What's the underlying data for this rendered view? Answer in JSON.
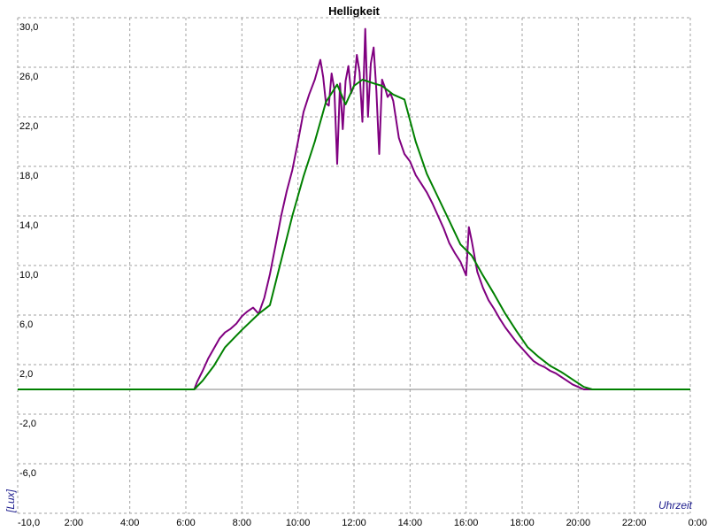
{
  "chart_data": {
    "type": "line",
    "title": "Helligkeit",
    "ylabel": "[Lux]",
    "xlabel": "Uhrzeit",
    "ylim": [
      -10,
      30
    ],
    "xlim": [
      0,
      24
    ],
    "y_ticks": [
      "30,0",
      "26,0",
      "22,0",
      "18,0",
      "14,0",
      "10,0",
      "6,0",
      "2,0",
      "-2,0",
      "-6,0"
    ],
    "x_tick_labels": [
      "-10,0",
      "2:00",
      "4:00",
      "6:00",
      "8:00",
      "10:00",
      "12:00",
      "14:00",
      "16:00",
      "18:00",
      "20:00",
      "22:00",
      "0:00"
    ],
    "grid": true,
    "colors": {
      "measured": "#800080",
      "smoothed": "#008000",
      "baseline": "#808080",
      "grid": "#a0a0a0",
      "axis_label": "#1a1a8c"
    },
    "series": [
      {
        "key": "measured",
        "x": [
          0,
          6.3,
          6.4,
          6.6,
          6.8,
          7.0,
          7.2,
          7.4,
          7.6,
          7.8,
          8.0,
          8.2,
          8.4,
          8.6,
          8.8,
          9.0,
          9.2,
          9.4,
          9.6,
          9.8,
          10.0,
          10.2,
          10.4,
          10.6,
          10.8,
          10.9,
          11.0,
          11.1,
          11.2,
          11.3,
          11.4,
          11.5,
          11.6,
          11.7,
          11.8,
          11.9,
          12.0,
          12.1,
          12.2,
          12.3,
          12.4,
          12.5,
          12.6,
          12.7,
          12.8,
          12.9,
          13.0,
          13.1,
          13.2,
          13.3,
          13.4,
          13.6,
          13.8,
          14.0,
          14.2,
          14.4,
          14.6,
          14.8,
          15.0,
          15.2,
          15.4,
          15.6,
          15.8,
          16.0,
          16.1,
          16.2,
          16.4,
          16.6,
          16.8,
          17.0,
          17.2,
          17.4,
          17.6,
          17.8,
          18.0,
          18.2,
          18.4,
          18.6,
          18.8,
          19.0,
          19.2,
          19.4,
          19.6,
          19.8,
          20.0,
          20.2,
          20.4,
          20.6,
          24
        ],
        "y": [
          0,
          0,
          0.6,
          1.5,
          2.5,
          3.3,
          4.1,
          4.6,
          4.9,
          5.3,
          5.9,
          6.3,
          6.6,
          6.1,
          7.4,
          9.3,
          11.6,
          14.0,
          16.0,
          17.7,
          20.0,
          22.4,
          23.8,
          25.0,
          26.6,
          25.2,
          23.1,
          22.9,
          25.5,
          24.2,
          18.2,
          24.7,
          21.0,
          24.9,
          26.1,
          23.9,
          24.5,
          27.0,
          25.6,
          21.6,
          29.1,
          22.0,
          26.3,
          27.6,
          24.1,
          19.0,
          25.0,
          24.4,
          23.6,
          23.9,
          23.3,
          20.3,
          19.0,
          18.4,
          17.3,
          16.6,
          15.9,
          15.0,
          14.0,
          13.0,
          11.8,
          11.0,
          10.3,
          9.2,
          13.1,
          12.0,
          9.5,
          8.2,
          7.2,
          6.5,
          5.7,
          5.0,
          4.4,
          3.8,
          3.3,
          2.8,
          2.3,
          2.0,
          1.8,
          1.5,
          1.3,
          1.0,
          0.7,
          0.4,
          0.2,
          0.0,
          0,
          0,
          0
        ]
      },
      {
        "key": "smoothed",
        "x": [
          0,
          6.3,
          6.6,
          7.0,
          7.4,
          8.0,
          8.6,
          9.0,
          9.4,
          9.8,
          10.2,
          10.6,
          11.0,
          11.4,
          11.7,
          12.0,
          12.3,
          12.7,
          13.0,
          13.4,
          13.8,
          14.2,
          14.6,
          15.0,
          15.4,
          15.8,
          16.2,
          16.6,
          17.0,
          17.4,
          17.8,
          18.2,
          18.6,
          19.0,
          19.4,
          19.8,
          20.2,
          20.5,
          24
        ],
        "y": [
          0,
          0,
          0.7,
          1.9,
          3.4,
          4.8,
          6.1,
          6.8,
          10.4,
          14.0,
          17.2,
          20.0,
          23.2,
          24.6,
          23.0,
          24.5,
          25.0,
          24.7,
          24.5,
          23.8,
          23.4,
          20.0,
          17.4,
          15.5,
          13.6,
          11.7,
          10.8,
          9.2,
          7.7,
          6.1,
          4.7,
          3.4,
          2.6,
          1.9,
          1.4,
          0.8,
          0.2,
          0,
          0
        ]
      }
    ]
  }
}
